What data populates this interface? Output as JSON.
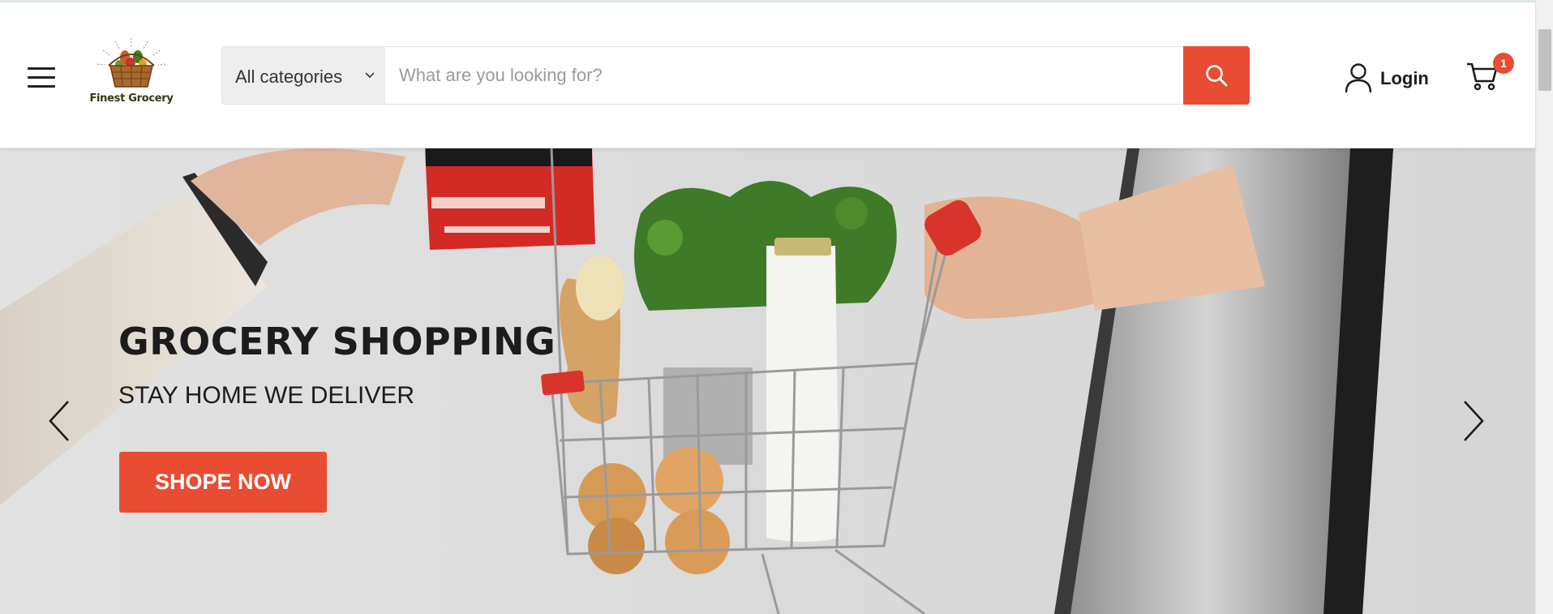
{
  "brand": {
    "name": "Finest Grocery"
  },
  "header": {
    "menu_icon": "hamburger-menu-icon",
    "search": {
      "category_label": "All categories",
      "placeholder": "What are you looking for?",
      "value": "",
      "button_icon": "search-icon"
    },
    "login_label": "Login",
    "cart_count": "1"
  },
  "hero": {
    "title": "GROCERY SHOPPING",
    "subtitle": "STAY HOME WE DELIVER",
    "cta_label": "SHOPE NOW",
    "prev_icon": "chevron-left-icon",
    "next_icon": "chevron-right-icon"
  },
  "colors": {
    "accent": "#e84c33",
    "text": "#1c1c1c",
    "hero_bg": "#dcdcdc"
  }
}
